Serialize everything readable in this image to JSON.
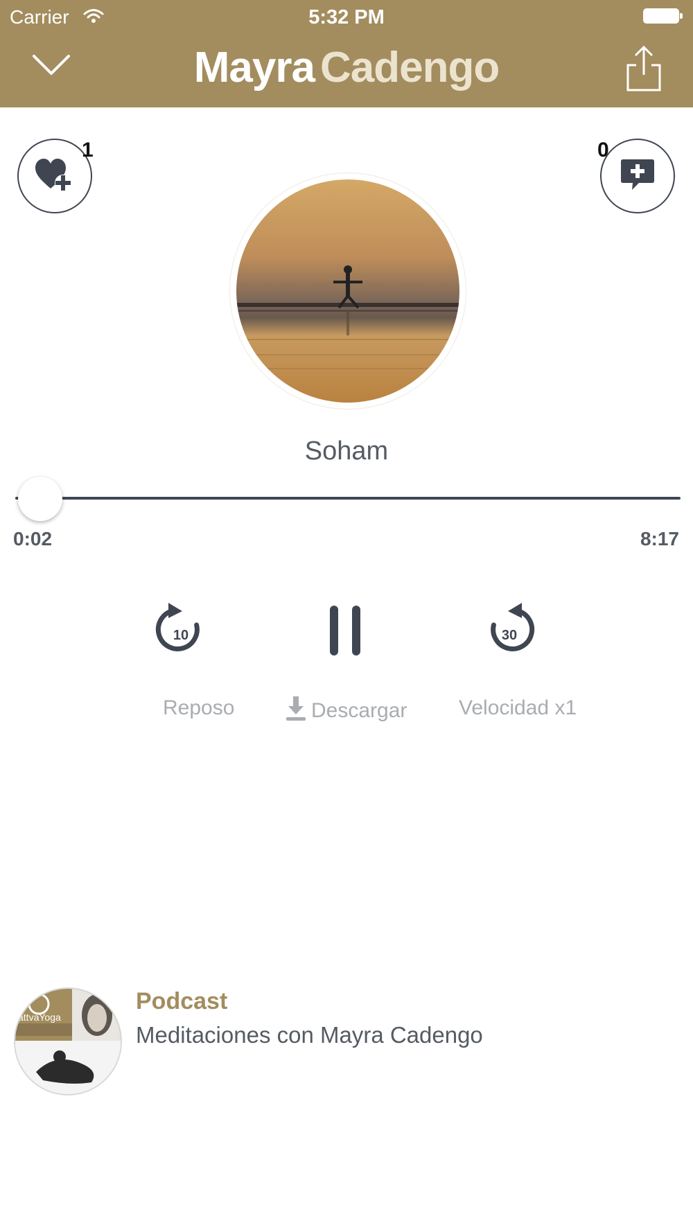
{
  "status_bar": {
    "carrier": "Carrier",
    "time": "5:32 PM"
  },
  "header": {
    "brand_part1": "Mayra",
    "brand_part2": "Cadengo",
    "colors": {
      "background": "#a38d5e",
      "text": "#ffffff"
    }
  },
  "actions": {
    "likes_count": "1",
    "comments_count": "0"
  },
  "player": {
    "title": "Soham",
    "elapsed": "0:02",
    "duration": "8:17",
    "progress": 0.004,
    "rewind_seconds": "10",
    "forward_seconds": "30"
  },
  "options": {
    "sleep": "Reposo",
    "download": "Descargar",
    "speed": "Velocidad x1"
  },
  "podcast": {
    "label": "Podcast",
    "name": "Meditaciones con Mayra Cadengo",
    "thumb_text": "attvaYoga"
  },
  "icons": [
    "wifi-icon",
    "battery-icon",
    "chevron-down-icon",
    "share-icon",
    "heart-plus-icon",
    "comment-plus-icon",
    "rewind-10-icon",
    "pause-icon",
    "forward-30-icon",
    "download-icon"
  ],
  "colors": {
    "accent": "#a38d5e",
    "dark": "#3f4652",
    "muted": "#a9acb0"
  }
}
